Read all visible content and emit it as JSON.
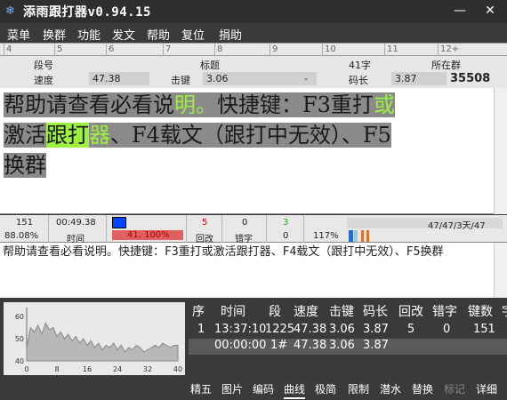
{
  "window": {
    "title": "添雨跟打器v0.94.15",
    "minimize": "—",
    "close": "✕"
  },
  "menu": [
    "菜单",
    "换群",
    "功能",
    "发文",
    "帮助",
    "复位",
    "捐助"
  ],
  "ruler": [
    "4",
    "5",
    "6",
    "7",
    "8",
    "9",
    "10",
    "11",
    "12+"
  ],
  "info": {
    "seg_label": "段号",
    "title_label": "标题",
    "char_count": "41字",
    "group_label": "所在群",
    "speed_label": "速度",
    "speed_value": "47.38",
    "keystroke_label": "击键",
    "keystroke_value": "3.06",
    "dash": "-",
    "codelen_label": "码长",
    "codelen_value": "3.87",
    "group_value": "35508"
  },
  "text_lines": {
    "line1_a": "帮助请查看必看说",
    "line1_b": "明。",
    "line1_c": "快捷键：F3重打",
    "line1_d": "或",
    "line2_a": "激活",
    "line2_b": "跟打",
    "line2_c": "器",
    "line2_d": "、F4载文（跟打中无效）、F5",
    "line3_a": "换群"
  },
  "stats": {
    "count": "151",
    "accuracy": "88.08%",
    "time_value": "00:49.38",
    "time_label": "时间",
    "progress_text": "41, 100%",
    "backspace_value": "5",
    "backspace_label": "回改",
    "error_value": "0",
    "error_label": "错字",
    "green_value": "3",
    "zero_value": "0",
    "percent": "117%",
    "summary": "47/47/3天/47"
  },
  "input_text": "帮助请查看必看说明。快捷键：F3重打或激活跟打器、F4载文（跟打中无效）、F5换群",
  "chart_data": {
    "type": "area",
    "x_ticks": [
      "0",
      "8",
      "16",
      "24",
      "32",
      "40"
    ],
    "y_ticks": [
      "40",
      "50",
      "60"
    ],
    "xlim": [
      0,
      40
    ],
    "ylim": [
      40,
      64
    ],
    "x": [
      0,
      1,
      2,
      3,
      4,
      5,
      6,
      7,
      8,
      9,
      10,
      11,
      12,
      13,
      14,
      15,
      16,
      17,
      18,
      19,
      20,
      21,
      22,
      23,
      24,
      25,
      26,
      27,
      28,
      29,
      30,
      31,
      32,
      33,
      34,
      35,
      36,
      37,
      38,
      39,
      40
    ],
    "values": [
      46,
      55,
      53,
      56,
      52,
      57,
      54,
      55,
      51,
      53,
      50,
      52,
      49,
      51,
      48,
      50,
      47,
      49,
      46,
      48,
      45,
      47,
      46,
      48,
      45,
      47,
      44,
      46,
      45,
      47,
      46,
      44,
      45,
      46,
      47,
      46,
      48,
      47,
      46,
      47,
      47
    ]
  },
  "table": {
    "headers": [
      "序",
      "时间",
      "段",
      "速度",
      "击键",
      "码长",
      "回改",
      "错字",
      "键数",
      "字"
    ],
    "row1": [
      "1",
      "13:37:10",
      "1225",
      "47.38",
      "3.06",
      "3.87",
      "5",
      "0",
      "151",
      ""
    ],
    "row2": [
      "",
      "00:00:00",
      "1#",
      "47.38",
      "3.06",
      "3.87",
      "",
      "",
      "",
      ""
    ]
  },
  "tabs": [
    "精五",
    "图片",
    "编码",
    "曲线",
    "极简",
    "限制",
    "潜水",
    "替换",
    "标记",
    "详细"
  ],
  "colors": {
    "highlight_green": "#9ef040",
    "typed_gray": "#8a8a8a",
    "curve_fill": "#b8b8b8"
  }
}
